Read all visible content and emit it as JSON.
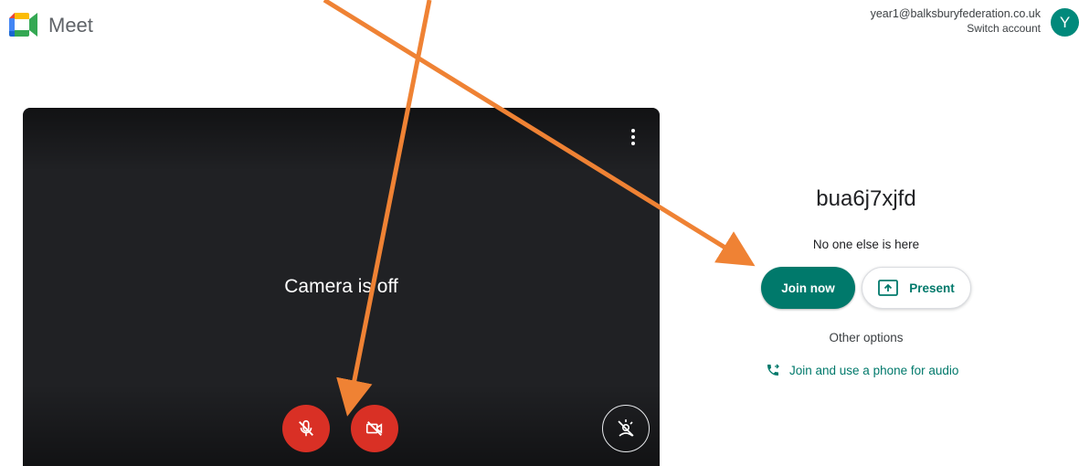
{
  "header": {
    "app_name": "Meet",
    "account_email": "year1@balksburyfederation.co.uk",
    "switch_account": "Switch account",
    "avatar_initial": "Y"
  },
  "preview": {
    "camera_status": "Camera is off",
    "microphone_state": "off",
    "camera_state": "off"
  },
  "meeting": {
    "code": "bua6j7xjfd",
    "status": "No one else is here",
    "join_label": "Join now",
    "present_label": "Present",
    "other_options_label": "Other options",
    "phone_audio_label": "Join and use a phone for audio"
  },
  "icons": {
    "logo": "google-meet-logo",
    "more": "more-vert-icon",
    "mic": "mic-off-icon",
    "camera": "videocam-off-icon",
    "effects": "visual-effects-icon",
    "present": "present-to-all-icon",
    "phone": "phone-forwarded-icon"
  },
  "colors": {
    "accent": "#00796b",
    "danger": "#d93025",
    "annotation_arrow": "#ef8234",
    "preview_bg": "#202124"
  }
}
